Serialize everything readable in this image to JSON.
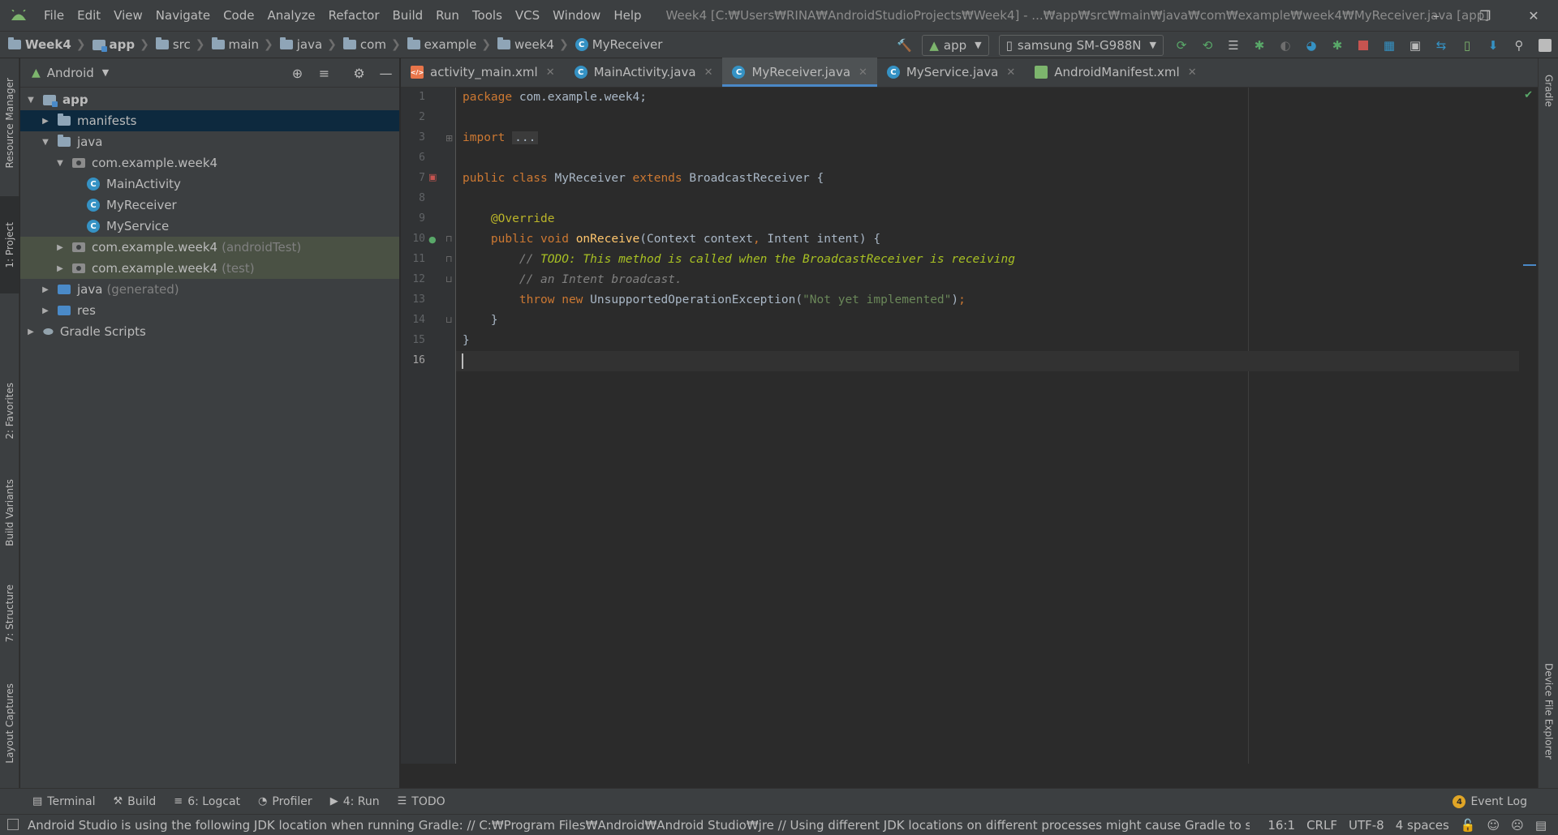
{
  "menubar": {
    "items": [
      "File",
      "Edit",
      "View",
      "Navigate",
      "Code",
      "Analyze",
      "Refactor",
      "Build",
      "Run",
      "Tools",
      "VCS",
      "Window",
      "Help"
    ],
    "window_title": "Week4 [C:₩Users₩RINA₩AndroidStudioProjects₩Week4] - ...₩app₩src₩main₩java₩com₩example₩week4₩MyReceiver.java [app]"
  },
  "breadcrumbs": {
    "items": [
      {
        "label": "Week4",
        "icon": "project-folder-icon",
        "bold": true
      },
      {
        "label": "app",
        "icon": "module-icon",
        "bold": true
      },
      {
        "label": "src",
        "icon": "folder-icon"
      },
      {
        "label": "main",
        "icon": "folder-icon"
      },
      {
        "label": "java",
        "icon": "folder-icon"
      },
      {
        "label": "com",
        "icon": "folder-icon"
      },
      {
        "label": "example",
        "icon": "folder-icon"
      },
      {
        "label": "week4",
        "icon": "folder-icon"
      },
      {
        "label": "MyReceiver",
        "icon": "class-icon"
      }
    ]
  },
  "toolbar": {
    "run_config": "app",
    "device": "samsung SM-G988N"
  },
  "project_panel": {
    "view_mode": "Android",
    "tree": [
      {
        "label": "app",
        "depth": 0,
        "expanded": true,
        "icon": "module-icon",
        "bold": true
      },
      {
        "label": "manifests",
        "depth": 1,
        "expanded": false,
        "icon": "folder-icon",
        "selected": true
      },
      {
        "label": "java",
        "depth": 1,
        "expanded": true,
        "icon": "folder-icon"
      },
      {
        "label": "com.example.week4",
        "depth": 2,
        "expanded": true,
        "icon": "package-icon"
      },
      {
        "label": "MainActivity",
        "depth": 3,
        "icon": "class-icon"
      },
      {
        "label": "MyReceiver",
        "depth": 3,
        "icon": "class-icon"
      },
      {
        "label": "MyService",
        "depth": 3,
        "icon": "class-icon"
      },
      {
        "label": "com.example.week4",
        "suffix": "(androidTest)",
        "depth": 2,
        "expanded": false,
        "icon": "package-icon",
        "highlight": true
      },
      {
        "label": "com.example.week4",
        "suffix": "(test)",
        "depth": 2,
        "expanded": false,
        "icon": "package-icon",
        "highlight": true
      },
      {
        "label": "java",
        "suffix": "(generated)",
        "depth": 1,
        "expanded": false,
        "icon": "generated-folder-icon"
      },
      {
        "label": "res",
        "depth": 1,
        "expanded": false,
        "icon": "res-folder-icon"
      },
      {
        "label": "Gradle Scripts",
        "depth": 0,
        "expanded": false,
        "icon": "gradle-icon"
      }
    ]
  },
  "left_tool_tabs": [
    "Resource Manager",
    "1: Project",
    "2: Favorites",
    "Build Variants",
    "7: Structure",
    "Layout Captures"
  ],
  "right_tool_tabs": [
    "Gradle",
    "Device File Explorer"
  ],
  "editor_tabs": [
    {
      "label": "activity_main.xml",
      "icon": "xml-file-icon",
      "active": false
    },
    {
      "label": "MainActivity.java",
      "icon": "class-icon",
      "active": false
    },
    {
      "label": "MyReceiver.java",
      "icon": "class-icon",
      "active": true
    },
    {
      "label": "MyService.java",
      "icon": "class-icon",
      "active": false
    },
    {
      "label": "AndroidManifest.xml",
      "icon": "manifest-file-icon",
      "active": false
    }
  ],
  "editor": {
    "current_line": 16,
    "lines": [
      {
        "n": "1",
        "tokens": [
          [
            "kw",
            "package "
          ],
          [
            "plain",
            "com.example.week4;"
          ]
        ]
      },
      {
        "n": "2",
        "tokens": []
      },
      {
        "n": "3",
        "tokens": [
          [
            "kw",
            "import "
          ],
          [
            "fold",
            "..."
          ]
        ]
      },
      {
        "n": "6",
        "tokens": []
      },
      {
        "n": "7",
        "tokens": [
          [
            "kw",
            "public class "
          ],
          [
            "plain",
            "MyReceiver "
          ],
          [
            "kw",
            "extends "
          ],
          [
            "plain",
            "BroadcastReceiver {"
          ]
        ]
      },
      {
        "n": "8",
        "tokens": []
      },
      {
        "n": "9",
        "tokens": [
          [
            "plain",
            "    "
          ],
          [
            "ann",
            "@Override"
          ]
        ]
      },
      {
        "n": "10",
        "tokens": [
          [
            "plain",
            "    "
          ],
          [
            "kw",
            "public void "
          ],
          [
            "fn",
            "onReceive"
          ],
          [
            "plain",
            "(Context context"
          ],
          [
            "kw",
            ", "
          ],
          [
            "plain",
            "Intent intent) {"
          ]
        ]
      },
      {
        "n": "11",
        "tokens": [
          [
            "plain",
            "        "
          ],
          [
            "cmt",
            "// "
          ],
          [
            "todo",
            "TODO: This method is called when the BroadcastReceiver is receiving"
          ]
        ]
      },
      {
        "n": "12",
        "tokens": [
          [
            "plain",
            "        "
          ],
          [
            "cmt",
            "// an Intent broadcast."
          ]
        ]
      },
      {
        "n": "13",
        "tokens": [
          [
            "plain",
            "        "
          ],
          [
            "kw",
            "throw new "
          ],
          [
            "plain",
            "UnsupportedOperationException("
          ],
          [
            "str",
            "\"Not yet implemented\""
          ],
          [
            "plain",
            ")"
          ],
          [
            "kw",
            ";"
          ]
        ]
      },
      {
        "n": "14",
        "tokens": [
          [
            "plain",
            "    }"
          ]
        ]
      },
      {
        "n": "15",
        "tokens": [
          [
            "plain",
            "}"
          ]
        ]
      },
      {
        "n": "16",
        "tokens": []
      }
    ]
  },
  "bottom_tabs": [
    {
      "label": "Terminal",
      "icon": "terminal-icon"
    },
    {
      "label": "Build",
      "icon": "hammer-icon"
    },
    {
      "label": "6: Logcat",
      "icon": "logcat-icon"
    },
    {
      "label": "Profiler",
      "icon": "profiler-icon"
    },
    {
      "label": "4: Run",
      "icon": "run-icon"
    },
    {
      "label": "TODO",
      "icon": "list-icon"
    }
  ],
  "event_log": {
    "label": "Event Log",
    "count": "4"
  },
  "statusbar": {
    "message": "Android Studio is using the following JDK location when running Gradle: // C:₩Program Files₩Android₩Android Studio₩jre // Using different JDK locations on different processes might cause Gradle to spa... (a minute ago)",
    "position": "16:1",
    "line_sep": "CRLF",
    "encoding": "UTF-8",
    "indent": "4 spaces"
  },
  "colors": {
    "accent": "#4a88c7",
    "android_green": "#7db56d",
    "keyword": "#cc7832",
    "annotation": "#bbb529",
    "function": "#ffc66d",
    "string": "#6a8759"
  }
}
